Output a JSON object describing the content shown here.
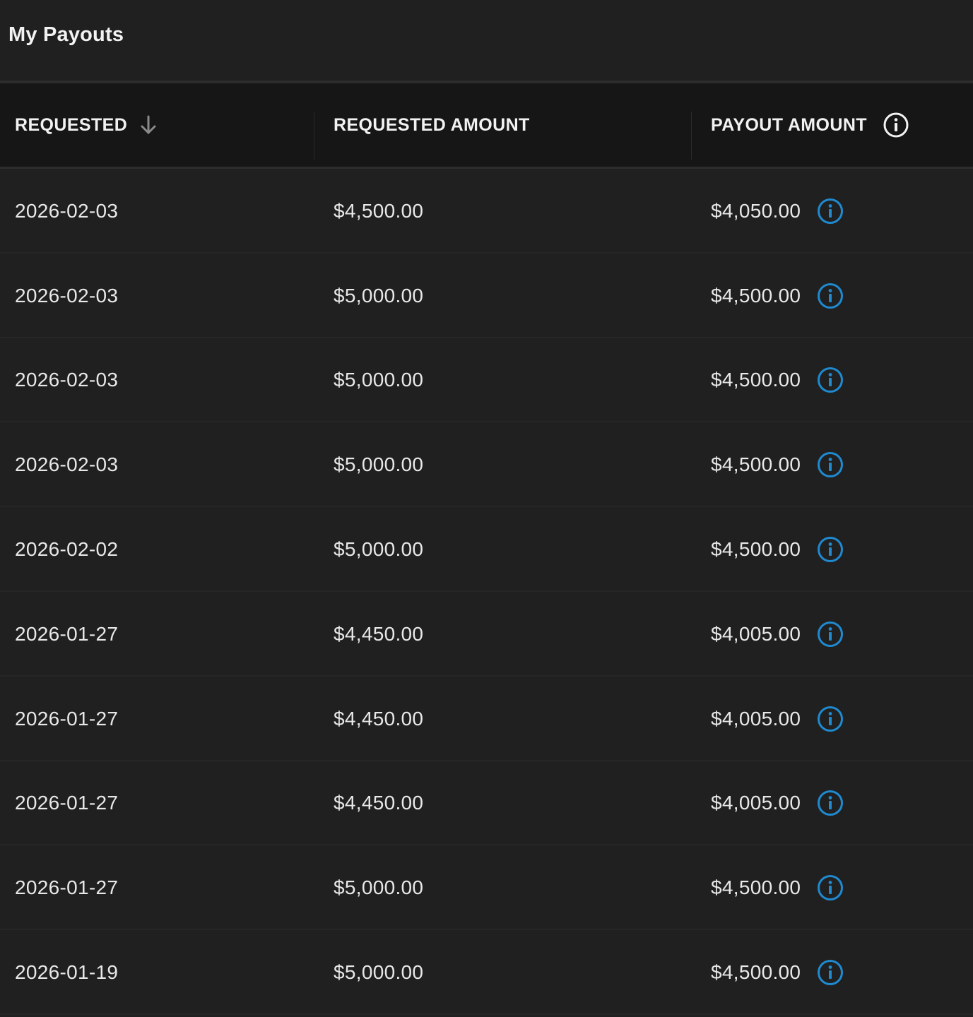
{
  "page": {
    "title": "My Payouts"
  },
  "table": {
    "columns": [
      {
        "label": "REQUESTED",
        "sort": "descending"
      },
      {
        "label": "REQUESTED AMOUNT"
      },
      {
        "label": "PAYOUT AMOUNT"
      }
    ],
    "rows": [
      {
        "requested": "2026-02-03",
        "requested_amount": "$4,500.00",
        "payout_amount": "$4,050.00"
      },
      {
        "requested": "2026-02-03",
        "requested_amount": "$5,000.00",
        "payout_amount": "$4,500.00"
      },
      {
        "requested": "2026-02-03",
        "requested_amount": "$5,000.00",
        "payout_amount": "$4,500.00"
      },
      {
        "requested": "2026-02-03",
        "requested_amount": "$5,000.00",
        "payout_amount": "$4,500.00"
      },
      {
        "requested": "2026-02-02",
        "requested_amount": "$5,000.00",
        "payout_amount": "$4,500.00"
      },
      {
        "requested": "2026-01-27",
        "requested_amount": "$4,450.00",
        "payout_amount": "$4,005.00"
      },
      {
        "requested": "2026-01-27",
        "requested_amount": "$4,450.00",
        "payout_amount": "$4,005.00"
      },
      {
        "requested": "2026-01-27",
        "requested_amount": "$4,450.00",
        "payout_amount": "$4,005.00"
      },
      {
        "requested": "2026-01-27",
        "requested_amount": "$5,000.00",
        "payout_amount": "$4,500.00"
      },
      {
        "requested": "2026-01-19",
        "requested_amount": "$5,000.00",
        "payout_amount": "$4,500.00"
      }
    ]
  },
  "icons": {
    "sort": "arrow-down-icon",
    "header_info": "info-circle-icon",
    "row_info": "info-circle-icon"
  },
  "colors": {
    "background": "#202021",
    "header_background": "#161617",
    "text": "#e8e8e8",
    "info_icon_blue": "#1f8ad0",
    "sort_icon": "#8a8a8a"
  }
}
